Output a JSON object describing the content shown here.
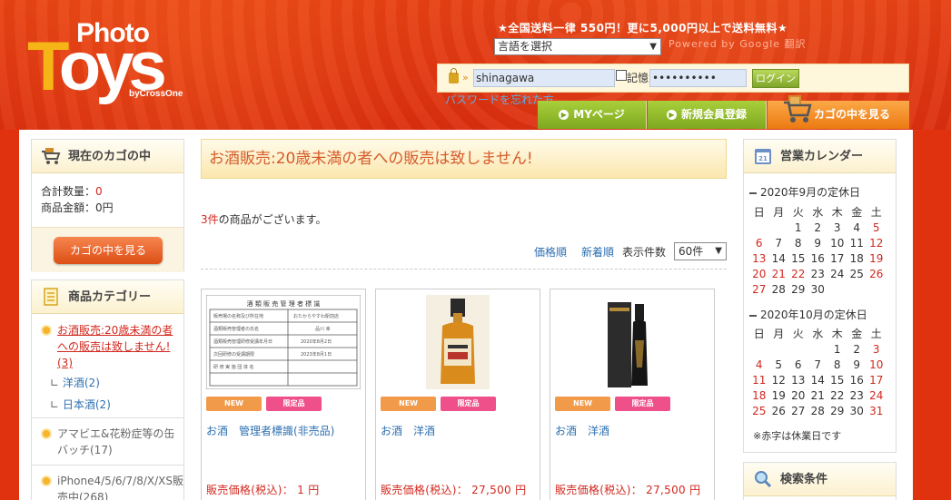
{
  "header": {
    "logo_photo": "Photo",
    "logo_t": "T",
    "logo_oys": "oys",
    "logo_by": "byCrossOne",
    "shipping": "★全国送料一律 550円！更に5,000円以上で送料無料★",
    "lang_select": "言語を選択",
    "powered": "Powered by Google 翻訳"
  },
  "login": {
    "id_value": "shinagawa",
    "remember_label": "記憶",
    "password_mask": "••••••••••",
    "login_button": "ログイン",
    "forgot_link": "パスワードを忘れた方"
  },
  "nav": {
    "mypage": "MYページ",
    "register": "新規会員登録",
    "cart": "カゴの中を見る"
  },
  "cart_box": {
    "title": "現在のカゴの中",
    "total_qty_label": "合計数量：",
    "total_qty": "0",
    "total_price": "商品金額：0円",
    "view_button": "カゴの中を見る"
  },
  "category_box": {
    "title": "商品カテゴリー",
    "items": [
      {
        "label": "お酒販売:20歳未満の者への販売は致しません!(3)"
      },
      {
        "label": "アマビエ&花粉症等の缶バッチ(17)"
      },
      {
        "label": "iPhone4/5/6/7/8/X/XS販売中(268)"
      }
    ],
    "sub_items": [
      "洋酒(2)",
      "日本酒(2)"
    ]
  },
  "main": {
    "notice": "お酒販売:20歳未満の者への販売は致しません!",
    "count_num": "3件",
    "count_text": "の商品がございます。",
    "sort_price": "価格順",
    "sort_new": "新着順",
    "per_page_label": "表示件数",
    "per_page_value": "60件",
    "products": [
      {
        "tag_new": "NEW",
        "tag_limited": "限定品",
        "name": "お酒　管理者標識(非売品)",
        "price": "販売価格(税込)： 1 円"
      },
      {
        "tag_new": "NEW",
        "tag_limited": "限定品",
        "name": "お酒　洋酒",
        "price": "販売価格(税込)： 27,500 円"
      },
      {
        "tag_new": "NEW",
        "tag_limited": "限定品",
        "name": "お酒　洋酒",
        "price": "販売価格(税込)： 27,500 円"
      }
    ]
  },
  "calendar": {
    "title": "営業カレンダー",
    "weekdays": [
      "日",
      "月",
      "火",
      "水",
      "木",
      "金",
      "土"
    ],
    "sep_title": "2020年9月の定休日",
    "oct_title": "2020年10月の定休日",
    "note": "※赤字は休業日です",
    "search_title": "検索条件"
  }
}
